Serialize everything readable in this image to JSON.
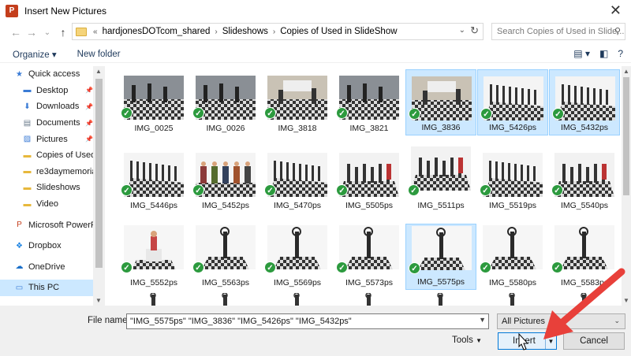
{
  "window": {
    "title": "Insert New Pictures",
    "app_icon_letter": "P"
  },
  "navigation": {
    "back_icon": "back-arrow-icon",
    "forward_icon": "forward-arrow-icon",
    "up_icon": "up-arrow-icon",
    "breadcrumb_overflow": "«",
    "breadcrumb": [
      "hardjonesDOTcom_shared",
      "Slideshows",
      "Copies of Used in SlideShow"
    ],
    "search_placeholder": "Search Copies of Used in Slide..."
  },
  "toolbar": {
    "organize": "Organize ▾",
    "new_folder": "New folder"
  },
  "sidebar": {
    "items": [
      {
        "label": "Quick access",
        "icon": "star-icon",
        "pinned": false
      },
      {
        "label": "Desktop",
        "icon": "desktop-icon",
        "pinned": true
      },
      {
        "label": "Downloads",
        "icon": "download-icon",
        "pinned": true
      },
      {
        "label": "Documents",
        "icon": "documents-icon",
        "pinned": true
      },
      {
        "label": "Pictures",
        "icon": "pictures-icon",
        "pinned": true
      },
      {
        "label": "Copies of Used i",
        "icon": "folder-icon",
        "pinned": false
      },
      {
        "label": "re3daymemorial",
        "icon": "folder-icon",
        "pinned": false
      },
      {
        "label": "Slideshows",
        "icon": "folder-icon",
        "pinned": false
      },
      {
        "label": "Video",
        "icon": "folder-icon",
        "pinned": false
      },
      {
        "label": "Microsoft PowerP",
        "icon": "powerpoint-icon",
        "pinned": false
      },
      {
        "label": "Dropbox",
        "icon": "dropbox-icon",
        "pinned": false
      },
      {
        "label": "OneDrive",
        "icon": "onedrive-icon",
        "pinned": false
      },
      {
        "label": "This PC",
        "icon": "computer-icon",
        "pinned": false
      }
    ]
  },
  "files": [
    {
      "name": "IMG_0025",
      "selected": false
    },
    {
      "name": "IMG_0026",
      "selected": false
    },
    {
      "name": "IMG_3818",
      "selected": false
    },
    {
      "name": "IMG_3821",
      "selected": false
    },
    {
      "name": "IMG_3836",
      "selected": true
    },
    {
      "name": "IMG_5426ps",
      "selected": true
    },
    {
      "name": "IMG_5432ps",
      "selected": true
    },
    {
      "name": "IMG_5446ps",
      "selected": false
    },
    {
      "name": "IMG_5452ps",
      "selected": false
    },
    {
      "name": "IMG_5470ps",
      "selected": false
    },
    {
      "name": "IMG_5505ps",
      "selected": false
    },
    {
      "name": "IMG_5511ps",
      "selected": false
    },
    {
      "name": "IMG_5519ps",
      "selected": false
    },
    {
      "name": "IMG_5540ps",
      "selected": false
    },
    {
      "name": "IMG_5552ps",
      "selected": false
    },
    {
      "name": "IMG_5563ps",
      "selected": false
    },
    {
      "name": "IMG_5569ps",
      "selected": false
    },
    {
      "name": "IMG_5573ps",
      "selected": false
    },
    {
      "name": "IMG_5575ps",
      "selected": true
    },
    {
      "name": "IMG_5580ps",
      "selected": false
    },
    {
      "name": "IMG_5583ps",
      "selected": false
    }
  ],
  "footer": {
    "file_name_label": "File name:",
    "file_name_value": "\"IMG_5575ps\" \"IMG_3836\" \"IMG_5426ps\" \"IMG_5432ps\"",
    "file_type": "All Pictures",
    "tools": "Tools",
    "insert": "Insert",
    "cancel": "Cancel"
  },
  "colors": {
    "selection": "#cce8ff",
    "check": "#2c9a3e",
    "arrow": "#e8403a",
    "accent": "#0078d7"
  }
}
